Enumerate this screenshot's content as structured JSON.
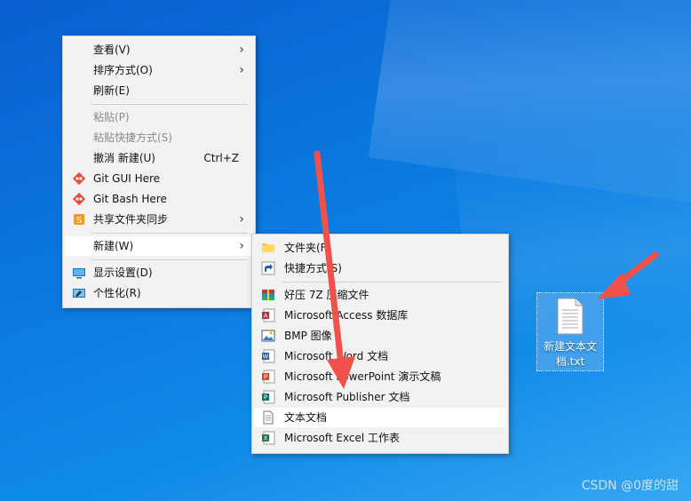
{
  "main_menu": {
    "items": [
      {
        "label": "查看(V)",
        "submenu": true
      },
      {
        "label": "排序方式(O)",
        "submenu": true
      },
      {
        "label": "刷新(E)"
      },
      {
        "label": "粘贴(P)",
        "disabled": true
      },
      {
        "label": "粘贴快捷方式(S)",
        "disabled": true
      },
      {
        "label": "撤消 新建(U)",
        "shortcut": "Ctrl+Z"
      },
      {
        "label": "Git GUI Here",
        "icon": "git-icon"
      },
      {
        "label": "Git Bash Here",
        "icon": "git-icon"
      },
      {
        "label": "共享文件夹同步",
        "icon": "share-sync-icon",
        "submenu": true
      },
      {
        "label": "新建(W)",
        "submenu": true,
        "highlighted": true
      },
      {
        "label": "显示设置(D)",
        "icon": "display-icon"
      },
      {
        "label": "个性化(R)",
        "icon": "personalize-icon"
      }
    ]
  },
  "new_submenu": {
    "items": [
      {
        "label": "文件夹(F)",
        "icon": "folder-icon"
      },
      {
        "label": "快捷方式(S)",
        "icon": "shortcut-icon"
      },
      {
        "label": "好压 7Z 压缩文件",
        "icon": "archive-icon"
      },
      {
        "label": "Microsoft Access 数据库",
        "icon": "access-icon"
      },
      {
        "label": "BMP 图像",
        "icon": "bmp-icon"
      },
      {
        "label": "Microsoft Word 文档",
        "icon": "word-icon"
      },
      {
        "label": "Microsoft PowerPoint 演示文稿",
        "icon": "powerpoint-icon"
      },
      {
        "label": "Microsoft Publisher 文档",
        "icon": "publisher-icon"
      },
      {
        "label": "文本文档",
        "icon": "text-doc-icon",
        "highlighted": true
      },
      {
        "label": "Microsoft Excel 工作表",
        "icon": "excel-icon"
      }
    ]
  },
  "desktop_file": {
    "name": "新建文本文档.txt",
    "icon": "text-file-icon"
  },
  "watermark": "CSDN @0度的甜",
  "colors": {
    "annotation_arrow": "#f0524a",
    "desktop": "#0b78e0",
    "menu_bg": "#f2f2f2"
  }
}
